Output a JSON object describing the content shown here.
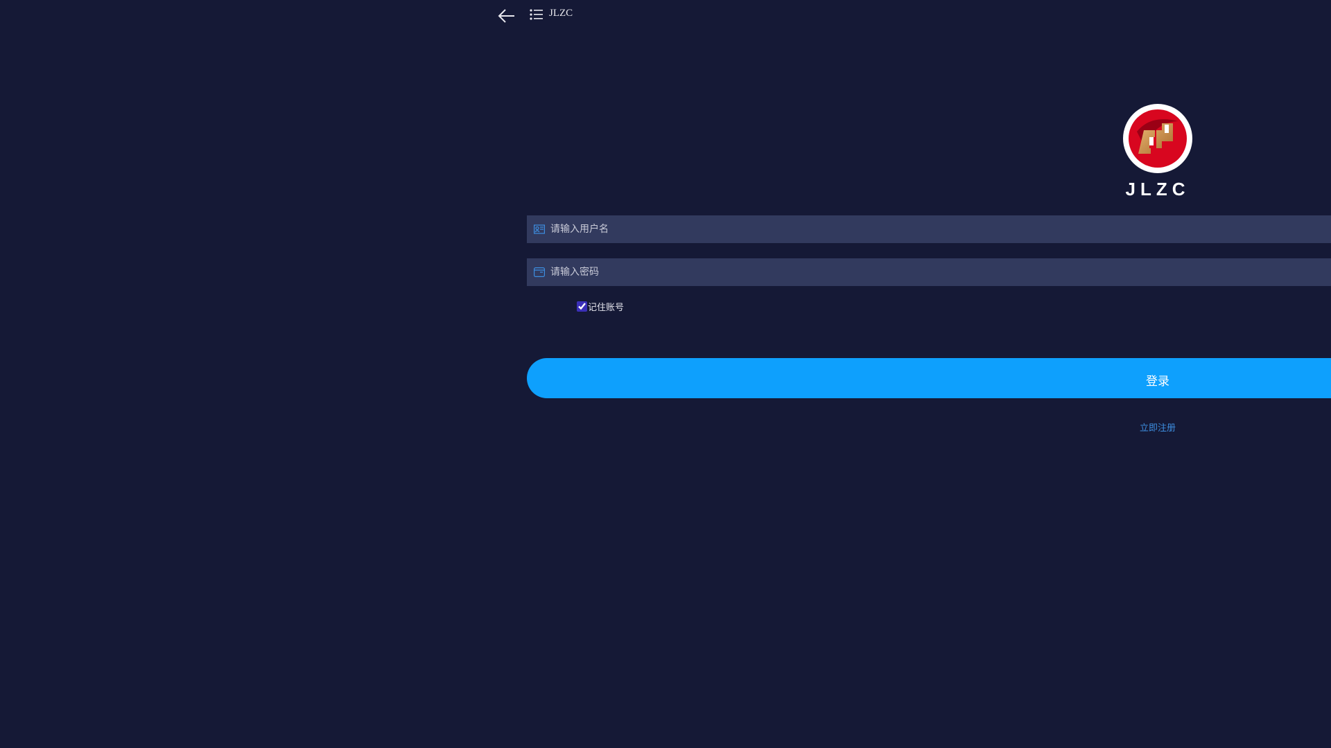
{
  "header": {
    "title": "JLZC",
    "back_icon": "arrow-left-icon",
    "menu_icon": "list-icon"
  },
  "brand": {
    "name": "JLZC"
  },
  "form": {
    "username_placeholder": "请输入用户名",
    "username_value": "",
    "password_placeholder": "请输入密码",
    "password_value": "",
    "remember_label": "记住账号",
    "remember_checked": true,
    "login_label": "登录",
    "register_label": "立即注册"
  },
  "colors": {
    "background": "#151936",
    "input": "#323a5e",
    "button": "#0ea0fd",
    "link": "#3d8ee0"
  }
}
